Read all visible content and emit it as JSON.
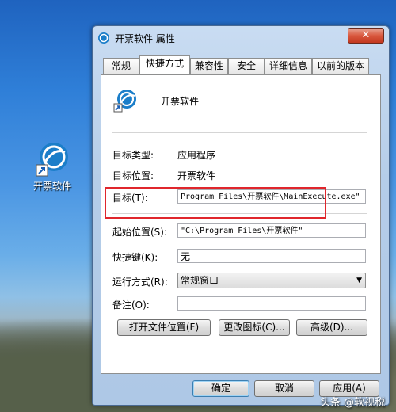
{
  "desktop": {
    "icon_label": "开票软件"
  },
  "window": {
    "title": "开票软件 属性",
    "close_symbol": "✕",
    "tabs": [
      "常规",
      "快捷方式",
      "兼容性",
      "安全",
      "详细信息",
      "以前的版本"
    ],
    "active_tab": "快捷方式",
    "program_name": "开票软件",
    "fields": {
      "target_type_label": "目标类型:",
      "target_type_value": "应用程序",
      "target_location_label": "目标位置:",
      "target_location_value": "开票软件",
      "target_label": "目标(T):",
      "target_value": "Program Files\\开票软件\\MainExecute.exe\"",
      "start_in_label": "起始位置(S):",
      "start_in_value": "\"C:\\Program Files\\开票软件\"",
      "shortcut_key_label": "快捷键(K):",
      "shortcut_key_value": "无",
      "run_label": "运行方式(R):",
      "run_value": "常规窗口",
      "comment_label": "备注(O):",
      "comment_value": ""
    },
    "buttons": {
      "open_location": "打开文件位置(F)",
      "change_icon": "更改图标(C)...",
      "advanced": "高级(D)..."
    },
    "footer": {
      "ok": "确定",
      "cancel": "取消",
      "apply": "应用(A)"
    }
  },
  "watermark": "头条 @软视税",
  "colors": {
    "highlight_box": "#e0262c",
    "close_button": "#c2371f"
  }
}
